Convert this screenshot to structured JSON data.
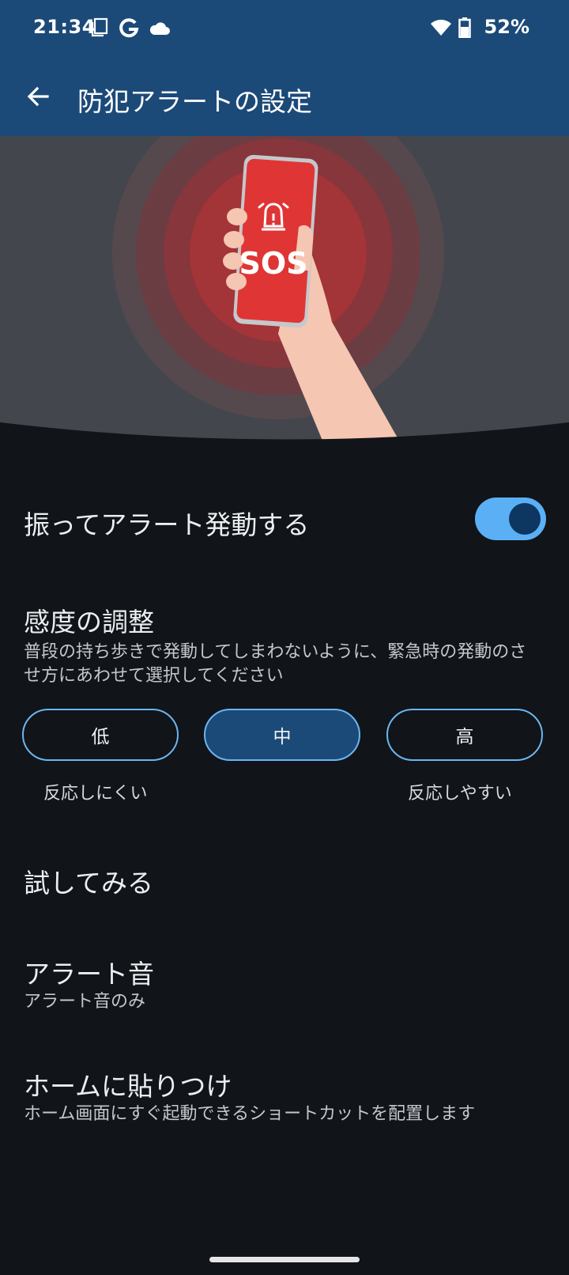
{
  "status_bar": {
    "time": "21:34",
    "icons": [
      "screenshot-icon",
      "google-g-icon",
      "cloud-icon",
      "wifi-icon",
      "battery-icon"
    ],
    "battery_percent": "52%"
  },
  "app_bar": {
    "title": "防犯アラートの設定",
    "back_icon": "arrow-back-icon"
  },
  "hero": {
    "phone_label": "SOS",
    "icons": [
      "alarm-bell-icon"
    ]
  },
  "shake_alert": {
    "title": "振ってアラート発動する",
    "enabled": true
  },
  "sensitivity": {
    "title": "感度の調整",
    "description": "普段の持ち歩きで発動してしまわないように、緊急時の発動のさせ方にあわせて選択してください",
    "options": [
      "低",
      "中",
      "高"
    ],
    "selected": "中",
    "caption_low": "反応しにくい",
    "caption_high": "反応しやすい"
  },
  "try_it": {
    "title": "試してみる"
  },
  "alert_sound": {
    "title": "アラート音",
    "value": "アラート音のみ"
  },
  "home_shortcut": {
    "title": "ホームに貼りつけ",
    "description": "ホーム画面にすぐ起動できるショートカットを配置します"
  },
  "colors": {
    "app_bar": "#1c4a78",
    "background": "#111418",
    "accent": "#5bb0f5",
    "alert_red": "#e03535"
  }
}
